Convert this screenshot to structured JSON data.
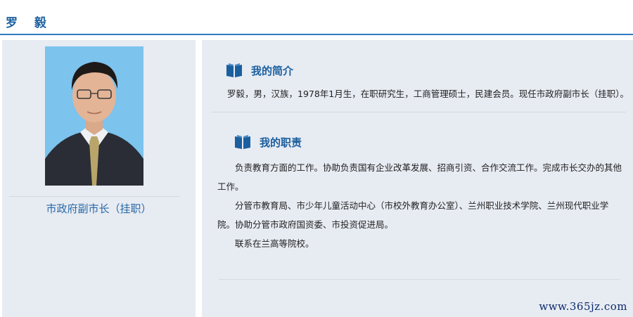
{
  "header": {
    "name": "罗 毅"
  },
  "profile": {
    "position_title": "市政府副市长（挂职）"
  },
  "intro": {
    "title": "我的简介",
    "text": "罗毅，男，汉族，1978年1月生，在职研究生，工商管理硕士，民建会员。现任市政府副市长（挂职）。"
  },
  "duties": {
    "title": "我的职责",
    "paragraphs": [
      "负责教育方面的工作。协助负责国有企业改革发展、招商引资、合作交流工作。完成市长交办的其他工作。",
      "分管市教育局、市少年儿童活动中心（市校外教育办公室）、兰州职业技术学院、兰州现代职业学院。协助分管市政府国资委、市投资促进局。",
      "联系在兰高等院校。"
    ]
  },
  "watermark": "www.365jz.com",
  "colors": {
    "accent": "#1a5f9e",
    "header_rule": "#2f7ac0",
    "panel_bg": "#e7ebf2",
    "photo_bg": "#7cc3ee"
  },
  "icons": {
    "section_icon": "book-icon"
  }
}
